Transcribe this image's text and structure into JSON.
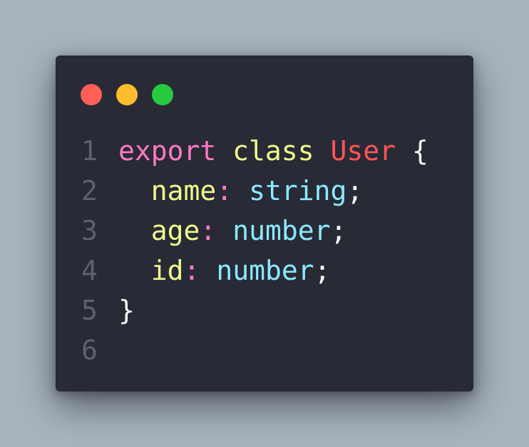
{
  "colors": {
    "background": "#a8b3bd",
    "window": "#282a36",
    "line_number": "#5c6170",
    "keyword": "#ff79c6",
    "class_kw": "#f1fa8c",
    "type_name": "#ff5555",
    "punct": "#f8f8f2",
    "property": "#f1fa8c",
    "colon": "#ff79c6",
    "type": "#8be9fd"
  },
  "window_controls": {
    "close": {
      "icon": "close-dot-icon",
      "color": "#ff5f56"
    },
    "minimize": {
      "icon": "minimize-dot-icon",
      "color": "#ffbd2e"
    },
    "maximize": {
      "icon": "maximize-dot-icon",
      "color": "#27c93f"
    }
  },
  "code": {
    "lines": [
      {
        "number": "1",
        "tokens": [
          {
            "text": "export",
            "kind": "keyword"
          },
          {
            "text": " ",
            "kind": "punct"
          },
          {
            "text": "class",
            "kind": "class_kw"
          },
          {
            "text": " ",
            "kind": "punct"
          },
          {
            "text": "User",
            "kind": "type_name"
          },
          {
            "text": " {",
            "kind": "punct"
          }
        ]
      },
      {
        "number": "2",
        "tokens": [
          {
            "text": "  ",
            "kind": "punct"
          },
          {
            "text": "name",
            "kind": "property"
          },
          {
            "text": ":",
            "kind": "colon"
          },
          {
            "text": " ",
            "kind": "punct"
          },
          {
            "text": "string",
            "kind": "type"
          },
          {
            "text": ";",
            "kind": "punct"
          }
        ]
      },
      {
        "number": "3",
        "tokens": [
          {
            "text": "  ",
            "kind": "punct"
          },
          {
            "text": "age",
            "kind": "property"
          },
          {
            "text": ":",
            "kind": "colon"
          },
          {
            "text": " ",
            "kind": "punct"
          },
          {
            "text": "number",
            "kind": "type"
          },
          {
            "text": ";",
            "kind": "punct"
          }
        ]
      },
      {
        "number": "4",
        "tokens": [
          {
            "text": "  ",
            "kind": "punct"
          },
          {
            "text": "id",
            "kind": "property"
          },
          {
            "text": ":",
            "kind": "colon"
          },
          {
            "text": " ",
            "kind": "punct"
          },
          {
            "text": "number",
            "kind": "type"
          },
          {
            "text": ";",
            "kind": "punct"
          }
        ]
      },
      {
        "number": "5",
        "tokens": [
          {
            "text": "}",
            "kind": "punct"
          }
        ]
      },
      {
        "number": "6",
        "tokens": []
      }
    ]
  }
}
